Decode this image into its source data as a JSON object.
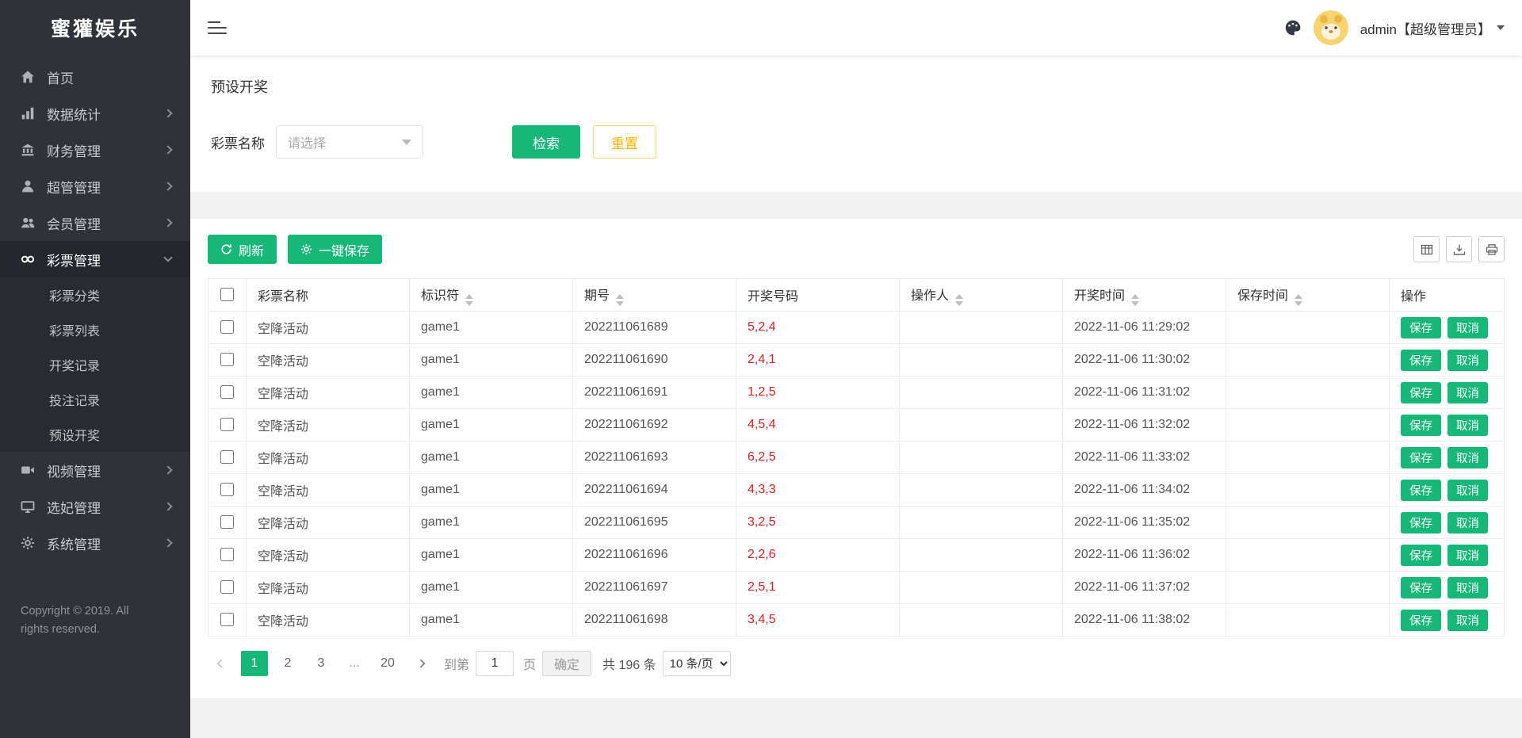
{
  "brand": "蜜獾娱乐",
  "topbar": {
    "user_label": "admin【超级管理员】"
  },
  "sidebar": {
    "items": [
      "首页",
      "数据统计",
      "财务管理",
      "超管管理",
      "会员管理",
      "彩票管理",
      "视频管理",
      "选妃管理",
      "系统管理"
    ],
    "lottery_submenu": [
      "彩票分类",
      "彩票列表",
      "开奖记录",
      "投注记录",
      "预设开奖"
    ],
    "copyright": "Copyright © 2019. All rights reserved."
  },
  "page": {
    "title": "预设开奖"
  },
  "filter": {
    "label": "彩票名称",
    "placeholder": "请选择",
    "search": "检索",
    "reset": "重置"
  },
  "toolbar": {
    "refresh": "刷新",
    "save_all": "一键保存"
  },
  "table": {
    "headers": [
      "彩票名称",
      "标识符",
      "期号",
      "开奖号码",
      "操作人",
      "开奖时间",
      "保存时间",
      "操作"
    ],
    "save_label": "保存",
    "cancel_label": "取消",
    "rows": [
      {
        "name": "空降活动",
        "code": "game1",
        "issue": "202211061689",
        "numbers": "5,2,4",
        "operator": "",
        "draw_time": "2022-11-06 11:29:02",
        "save_time": ""
      },
      {
        "name": "空降活动",
        "code": "game1",
        "issue": "202211061690",
        "numbers": "2,4,1",
        "operator": "",
        "draw_time": "2022-11-06 11:30:02",
        "save_time": ""
      },
      {
        "name": "空降活动",
        "code": "game1",
        "issue": "202211061691",
        "numbers": "1,2,5",
        "operator": "",
        "draw_time": "2022-11-06 11:31:02",
        "save_time": ""
      },
      {
        "name": "空降活动",
        "code": "game1",
        "issue": "202211061692",
        "numbers": "4,5,4",
        "operator": "",
        "draw_time": "2022-11-06 11:32:02",
        "save_time": ""
      },
      {
        "name": "空降活动",
        "code": "game1",
        "issue": "202211061693",
        "numbers": "6,2,5",
        "operator": "",
        "draw_time": "2022-11-06 11:33:02",
        "save_time": ""
      },
      {
        "name": "空降活动",
        "code": "game1",
        "issue": "202211061694",
        "numbers": "4,3,3",
        "operator": "",
        "draw_time": "2022-11-06 11:34:02",
        "save_time": ""
      },
      {
        "name": "空降活动",
        "code": "game1",
        "issue": "202211061695",
        "numbers": "3,2,5",
        "operator": "",
        "draw_time": "2022-11-06 11:35:02",
        "save_time": ""
      },
      {
        "name": "空降活动",
        "code": "game1",
        "issue": "202211061696",
        "numbers": "2,2,6",
        "operator": "",
        "draw_time": "2022-11-06 11:36:02",
        "save_time": ""
      },
      {
        "name": "空降活动",
        "code": "game1",
        "issue": "202211061697",
        "numbers": "2,5,1",
        "operator": "",
        "draw_time": "2022-11-06 11:37:02",
        "save_time": ""
      },
      {
        "name": "空降活动",
        "code": "game1",
        "issue": "202211061698",
        "numbers": "3,4,5",
        "operator": "",
        "draw_time": "2022-11-06 11:38:02",
        "save_time": ""
      }
    ]
  },
  "pagination": {
    "pages": [
      "1",
      "2",
      "3",
      "...",
      "20"
    ],
    "goto_label": "到第",
    "goto_value": "1",
    "page_unit": "页",
    "confirm": "确定",
    "total": "共 196 条",
    "page_size": "10 条/页"
  },
  "colors": {
    "accent": "#16b777",
    "warning": "#ffb800",
    "danger": "#e02020",
    "sidebar_bg": "#2f3339"
  }
}
